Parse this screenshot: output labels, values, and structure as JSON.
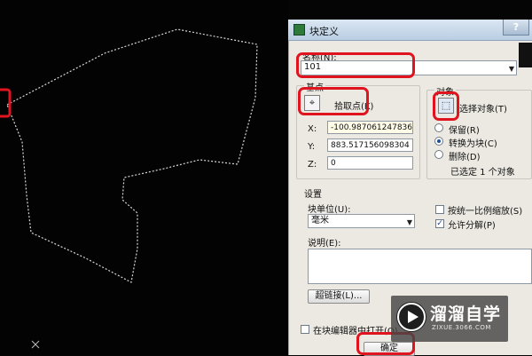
{
  "dialog": {
    "title": "块定义",
    "help": "?",
    "name_label": "名称(N):",
    "name_value": "101",
    "base_group": "基点",
    "pick_point": "拾取点(K)",
    "x_label": "X:",
    "x_value": "-100.9870612478362",
    "y_label": "Y:",
    "y_value": "883.517156098304",
    "z_label": "Z:",
    "z_value": "0",
    "objects_group": "对象",
    "select_objects": "选择对象(T)",
    "retain": "保留(R)",
    "convert": "转换为块(C)",
    "delete": "删除(D)",
    "selected_info": "已选定 1 个对象",
    "settings_group": "设置",
    "unit_label": "块单位(U):",
    "unit_value": "毫米",
    "uniform_scale": "按统一比例缩放(S)",
    "allow_explode": "允许分解(P)",
    "desc_label": "说明(E):",
    "hyperlink": "超链接(L)...",
    "open_in_editor": "在块编辑器中打开(O)",
    "ok": "确定"
  },
  "watermark": {
    "title": "溜溜自学",
    "url": "ZIXUE.3066.COM"
  },
  "colors": {
    "canvas": "#030303",
    "dialog_bg": "#ece9e2",
    "annotation_red": "#e0141e"
  }
}
